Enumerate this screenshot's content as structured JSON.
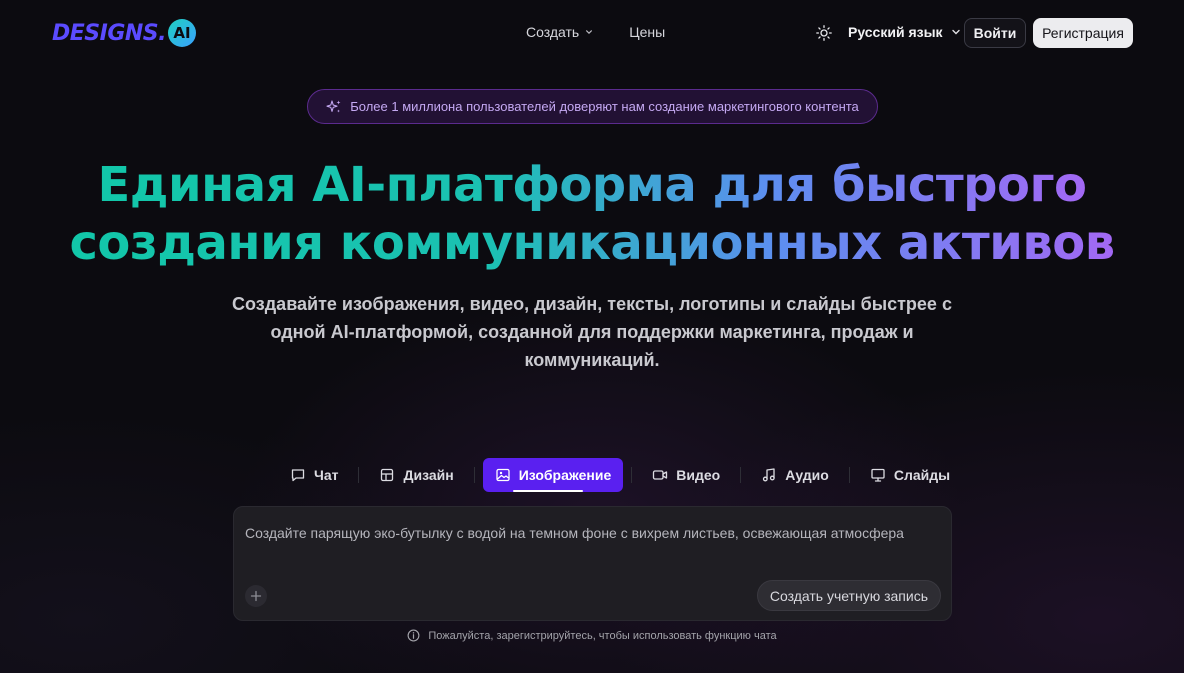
{
  "header": {
    "logo_text": "DESIGNS.",
    "logo_badge": "AI",
    "nav": [
      {
        "label": "Создать",
        "has_dropdown": true,
        "icon": "chevron-down-icon"
      },
      {
        "label": "Цены",
        "has_dropdown": false
      }
    ],
    "theme_icon": "sun-icon",
    "language": "Русский язык",
    "login_label": "Войти",
    "register_label": "Регистрация"
  },
  "promo": {
    "icon": "sparkles-icon",
    "text": "Более 1 миллиона пользователей доверяют нам создание маркетингового контента"
  },
  "hero": {
    "title_line1": "Единая AI-платформа для быстрого",
    "title_line2": "создания коммуникационных активов",
    "subtitle": "Создавайте изображения, видео, дизайн, тексты, логотипы и слайды быстрее с одной AI-платформой, созданной для поддержки маркетинга, продаж и коммуникаций."
  },
  "tabs": [
    {
      "label": "Чат",
      "icon": "chat-icon",
      "active": false
    },
    {
      "label": "Дизайн",
      "icon": "layout-icon",
      "active": false
    },
    {
      "label": "Изображение",
      "icon": "image-icon",
      "active": true
    },
    {
      "label": "Видео",
      "icon": "video-icon",
      "active": false
    },
    {
      "label": "Аудио",
      "icon": "music-icon",
      "active": false
    },
    {
      "label": "Слайды",
      "icon": "presentation-icon",
      "active": false
    }
  ],
  "prompt": {
    "text": "Создайте парящую эко-бутылку с водой на темном фоне с вихрем листьев, освежающая атмосфера",
    "add_icon": "plus-icon",
    "submit_label": "Создать учетную запись"
  },
  "notice": {
    "icon": "info-icon",
    "text": "Пожалуйста, зарегистрируйтесь, чтобы использовать функцию чата"
  },
  "colors": {
    "accent": "#5a20f0",
    "gradient_start": "#12c7a9",
    "gradient_end": "#a368f4",
    "promo_text": "#c4a8f2"
  }
}
